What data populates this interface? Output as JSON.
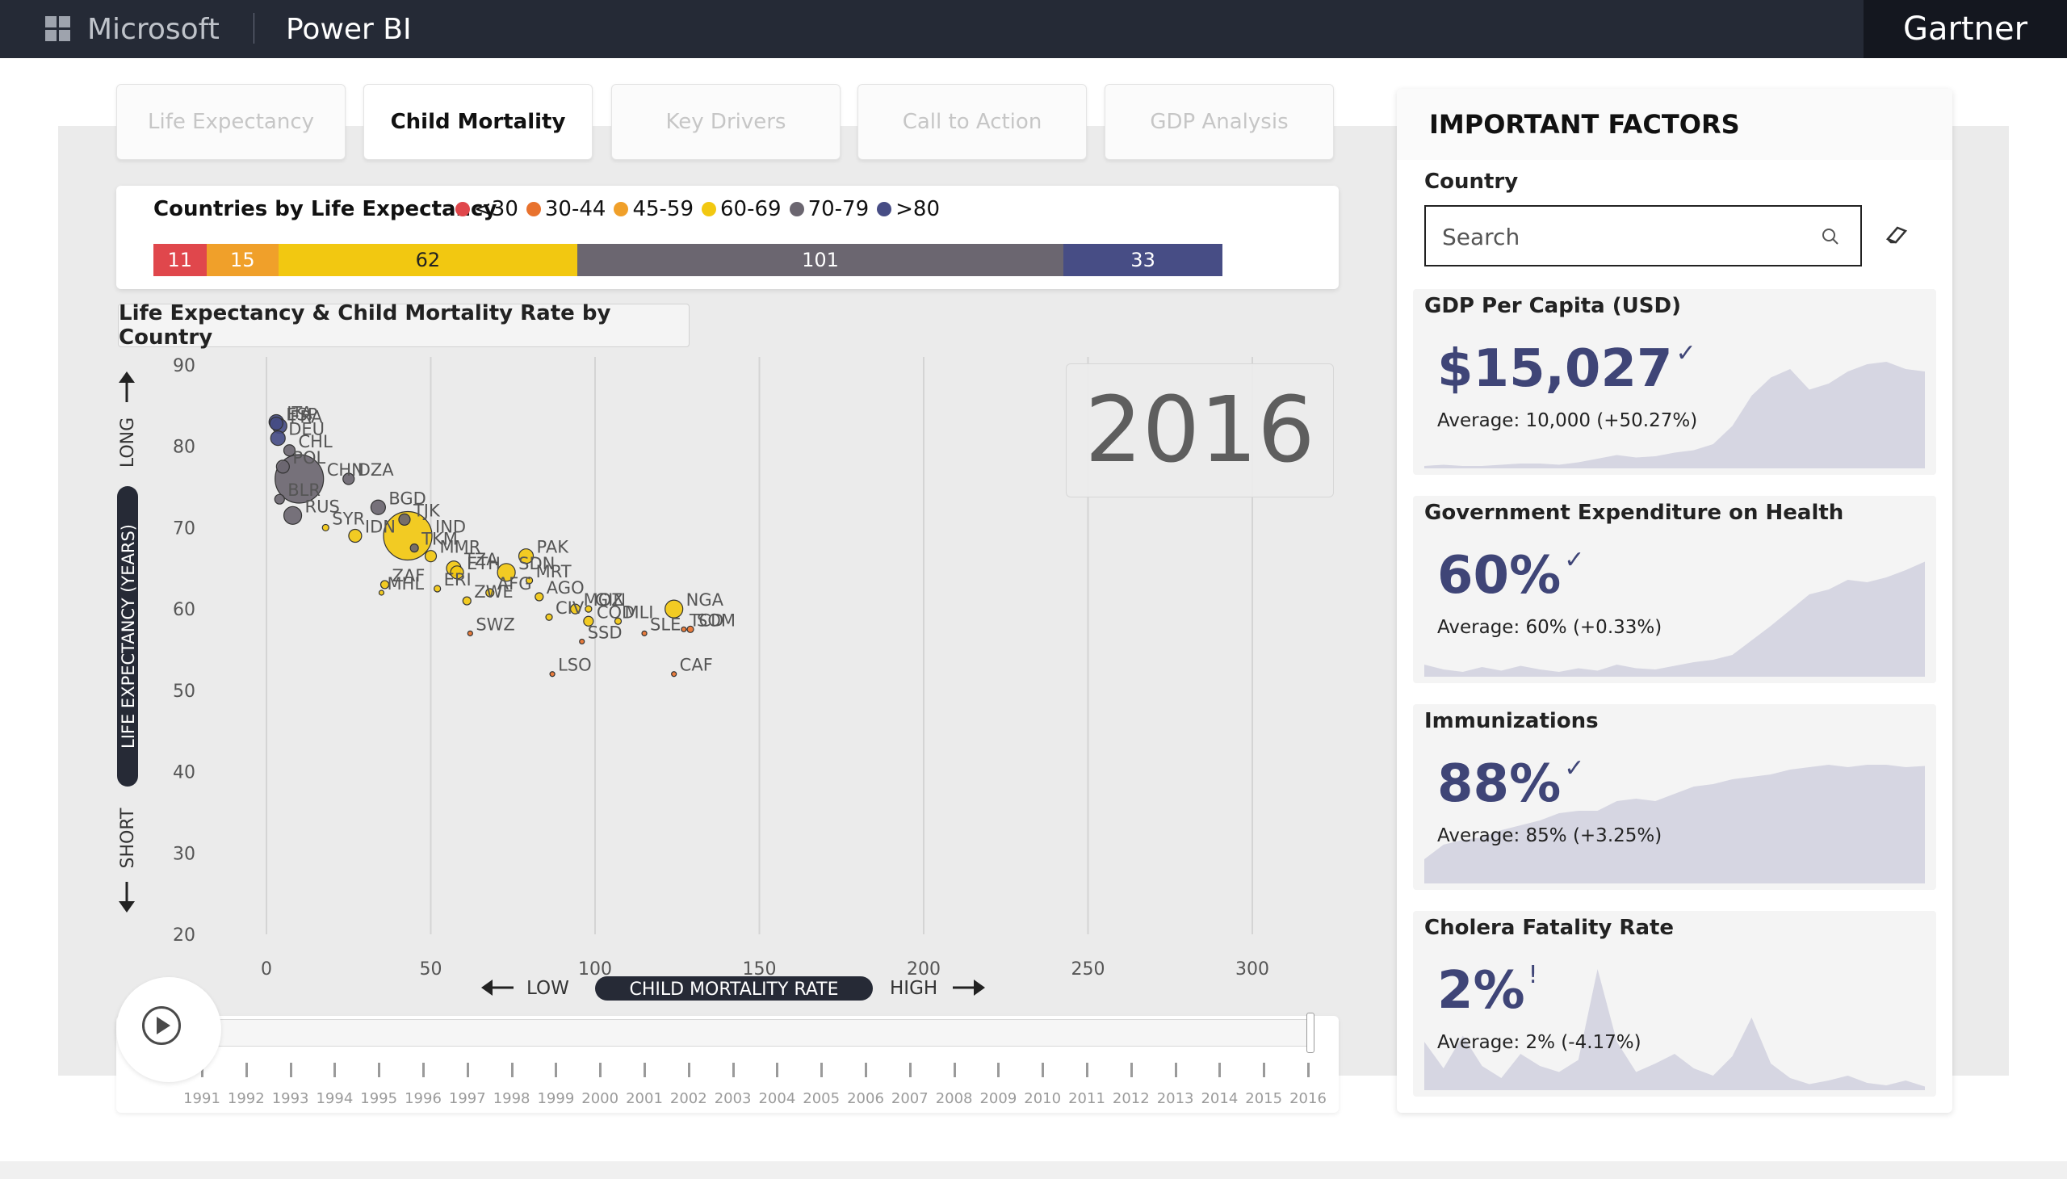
{
  "header": {
    "brand": "Microsoft",
    "product": "Power BI",
    "partner": "Gartner"
  },
  "tabs": [
    {
      "label": "Life Expectancy",
      "active": false
    },
    {
      "label": "Child Mortality",
      "active": true
    },
    {
      "label": "Key Drivers",
      "active": false
    },
    {
      "label": "Call to Action",
      "active": false
    },
    {
      "label": "GDP Analysis",
      "active": false
    }
  ],
  "legend": {
    "title": "Countries by Life Expectancy",
    "items": [
      {
        "label": "<30",
        "color": "#e0474c"
      },
      {
        "label": "30-44",
        "color": "#e8722e"
      },
      {
        "label": "45-59",
        "color": "#f0a02a"
      },
      {
        "label": "60-69",
        "color": "#f2c811"
      },
      {
        "label": "70-79",
        "color": "#6b6670"
      },
      {
        "label": ">80",
        "color": "#474d85"
      }
    ],
    "bar": [
      {
        "value": "11",
        "count": 11,
        "color": "#e0474c",
        "text_color": "#ffffff"
      },
      {
        "value": "15",
        "count": 15,
        "color": "#f0a02a",
        "text_color": "#ffffff"
      },
      {
        "value": "62",
        "count": 62,
        "color": "#f2c811",
        "text_color": "#222222"
      },
      {
        "value": "101",
        "count": 101,
        "color": "#6b6670",
        "text_color": "#ffffff"
      },
      {
        "value": "33",
        "count": 33,
        "color": "#474d85",
        "text_color": "#ffffff"
      }
    ]
  },
  "chart_title": "Life Expectancy & Child Mortality Rate by Country",
  "chart_data": {
    "type": "scatter",
    "title": "Life Expectancy & Child Mortality Rate by Country",
    "xlabel": "CHILD MORTALITY RATE",
    "ylabel": "LIFE EXPECTANCY (YEARS)",
    "x_low_label": "LOW",
    "x_high_label": "HIGH",
    "y_high_label": "LONG",
    "y_low_label": "SHORT",
    "xlim": [
      0,
      300
    ],
    "ylim": [
      20,
      90
    ],
    "x_ticks": [
      "0",
      "50",
      "100",
      "150",
      "200",
      "250",
      "300"
    ],
    "y_ticks": [
      "20",
      "30",
      "40",
      "50",
      "60",
      "70",
      "80",
      "90"
    ],
    "year": "2016",
    "points": [
      {
        "label": "ITA",
        "x": 3,
        "y": 83,
        "r": 9,
        "color": "#474d85"
      },
      {
        "label": "FRA",
        "x": 4,
        "y": 82.5,
        "r": 9,
        "color": "#474d85"
      },
      {
        "label": "ESP",
        "x": 3,
        "y": 82.8,
        "r": 8,
        "color": "#474d85"
      },
      {
        "label": "CHL",
        "x": 7,
        "y": 79.5,
        "r": 7,
        "color": "#6b6670"
      },
      {
        "label": "DEU",
        "x": 3.5,
        "y": 81,
        "r": 9,
        "color": "#474d85"
      },
      {
        "label": "DZA",
        "x": 25,
        "y": 76,
        "r": 7,
        "color": "#6b6670"
      },
      {
        "label": "BGD",
        "x": 34,
        "y": 72.5,
        "r": 9,
        "color": "#6b6670"
      },
      {
        "label": "TJK",
        "x": 42,
        "y": 71,
        "r": 7,
        "color": "#6b6670"
      },
      {
        "label": "POL",
        "x": 5,
        "y": 77.5,
        "r": 8,
        "color": "#6b6670"
      },
      {
        "label": "BLR",
        "x": 4,
        "y": 73.5,
        "r": 6,
        "color": "#6b6670"
      },
      {
        "label": "CHN",
        "x": 10,
        "y": 76,
        "r": 30,
        "color": "#6b6670"
      },
      {
        "label": "RUS",
        "x": 8,
        "y": 71.5,
        "r": 11,
        "color": "#6b6670"
      },
      {
        "label": "MMR",
        "x": 50,
        "y": 66.5,
        "r": 7,
        "color": "#f2c811"
      },
      {
        "label": "IND",
        "x": 43,
        "y": 69,
        "r": 30,
        "color": "#f2c811"
      },
      {
        "label": "SDN",
        "x": 73,
        "y": 64.5,
        "r": 11,
        "color": "#f2c811"
      },
      {
        "label": "MRT",
        "x": 80,
        "y": 63.5,
        "r": 4,
        "color": "#f2c811"
      },
      {
        "label": "AGO",
        "x": 83,
        "y": 61.5,
        "r": 5,
        "color": "#f2c811"
      },
      {
        "label": "TZA",
        "x": 57,
        "y": 65,
        "r": 9,
        "color": "#f2c811"
      },
      {
        "label": "PAK",
        "x": 79,
        "y": 66.5,
        "r": 9,
        "color": "#f2c811"
      },
      {
        "label": "IDN",
        "x": 27,
        "y": 69,
        "r": 8,
        "color": "#f2c811"
      },
      {
        "label": "TKM",
        "x": 45,
        "y": 67.5,
        "r": 5,
        "color": "#6b6670"
      },
      {
        "label": "SYR",
        "x": 18,
        "y": 70,
        "r": 4,
        "color": "#f2c811"
      },
      {
        "label": "ZAF",
        "x": 36,
        "y": 63,
        "r": 5,
        "color": "#f2c811"
      },
      {
        "label": "ERI",
        "x": 52,
        "y": 62.5,
        "r": 4,
        "color": "#f2c811"
      },
      {
        "label": "ETH",
        "x": 58,
        "y": 64.5,
        "r": 8,
        "color": "#f2c811"
      },
      {
        "label": "MOZ",
        "x": 94,
        "y": 60,
        "r": 6,
        "color": "#f2c811"
      },
      {
        "label": "GIN",
        "x": 98,
        "y": 60,
        "r": 4,
        "color": "#f2c811"
      },
      {
        "label": "MHL",
        "x": 35,
        "y": 62,
        "r": 3,
        "color": "#f2c811"
      },
      {
        "label": "ZWE",
        "x": 61,
        "y": 61,
        "r": 5,
        "color": "#f2c811"
      },
      {
        "label": "AFG",
        "x": 68,
        "y": 62,
        "r": 5,
        "color": "#f2c811"
      },
      {
        "label": "CIV",
        "x": 86,
        "y": 59,
        "r": 4,
        "color": "#f2c811"
      },
      {
        "label": "COD",
        "x": 98,
        "y": 58.5,
        "r": 6,
        "color": "#f2c811"
      },
      {
        "label": "MLI",
        "x": 107,
        "y": 58.5,
        "r": 4,
        "color": "#f2c811"
      },
      {
        "label": "SWZ",
        "x": 62,
        "y": 57,
        "r": 3,
        "color": "#e8722e"
      },
      {
        "label": "SSD",
        "x": 96,
        "y": 56,
        "r": 3,
        "color": "#e8722e"
      },
      {
        "label": "NGA",
        "x": 124,
        "y": 60,
        "r": 11,
        "color": "#f2c811"
      },
      {
        "label": "SOM",
        "x": 129,
        "y": 57.5,
        "r": 4,
        "color": "#e8722e"
      },
      {
        "label": "SLE",
        "x": 115,
        "y": 57,
        "r": 3,
        "color": "#e8722e"
      },
      {
        "label": "TCD",
        "x": 127,
        "y": 57.5,
        "r": 3,
        "color": "#e8722e"
      },
      {
        "label": "LSO",
        "x": 87,
        "y": 52,
        "r": 3,
        "color": "#e8722e"
      },
      {
        "label": "CAF",
        "x": 124,
        "y": 52,
        "r": 3,
        "color": "#e8722e"
      }
    ]
  },
  "timeline": {
    "years": [
      "1991",
      "1992",
      "1993",
      "1994",
      "1995",
      "1996",
      "1997",
      "1998",
      "1999",
      "2000",
      "2001",
      "2002",
      "2003",
      "2004",
      "2005",
      "2006",
      "2007",
      "2008",
      "2009",
      "2010",
      "2011",
      "2012",
      "2013",
      "2014",
      "2015",
      "2016"
    ],
    "selected": "2016"
  },
  "right_panel": {
    "title": "IMPORTANT FACTORS",
    "country_label": "Country",
    "search_placeholder": "Search",
    "kpis": [
      {
        "title": "GDP Per Capita (USD)",
        "value": "$15,027",
        "mark": "✓",
        "average": "Average: 10,000 (+50.27%)",
        "trend": [
          2,
          3,
          2,
          2,
          3,
          4,
          4,
          3,
          5,
          8,
          11,
          9,
          10,
          13,
          15,
          20,
          35,
          60,
          75,
          82,
          65,
          70,
          80,
          86,
          88,
          82,
          80
        ]
      },
      {
        "title": "Government Expenditure on Health",
        "value": "60%",
        "mark": "✓",
        "average": "Average: 60% (+0.33%)",
        "trend": [
          10,
          6,
          4,
          8,
          5,
          9,
          6,
          4,
          7,
          5,
          10,
          7,
          6,
          9,
          12,
          14,
          18,
          30,
          42,
          55,
          68,
          72,
          80,
          78,
          82,
          88,
          95
        ]
      },
      {
        "title": "Immunizations",
        "value": "88%",
        "mark": "✓",
        "average": "Average: 85% (+3.25%)",
        "trend": [
          20,
          32,
          36,
          38,
          44,
          48,
          52,
          58,
          60,
          60,
          68,
          70,
          68,
          74,
          80,
          82,
          86,
          88,
          90,
          94,
          96,
          98,
          96,
          98,
          98,
          96,
          97
        ]
      },
      {
        "title": "Cholera Fatality Rate",
        "value": "2%",
        "mark": "!",
        "average": "Average: 2% (-4.17%)",
        "trend": [
          40,
          18,
          45,
          20,
          10,
          30,
          20,
          15,
          25,
          100,
          40,
          15,
          22,
          30,
          18,
          12,
          28,
          60,
          22,
          10,
          5,
          8,
          12,
          6,
          4,
          8,
          3
        ]
      }
    ]
  }
}
